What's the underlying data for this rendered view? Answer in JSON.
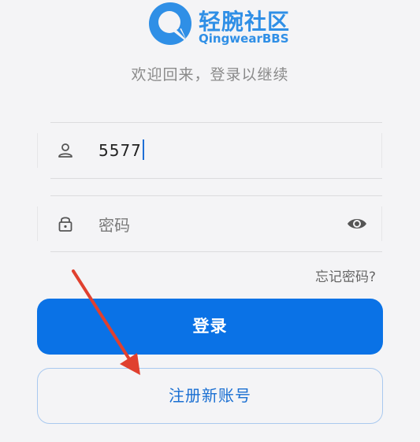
{
  "logo": {
    "cn_text": "轻腕社区",
    "en_text": "QingwearBBS"
  },
  "subtitle": "欢迎回来，登录以继续",
  "username_field": {
    "value": "5577",
    "icon": "user-icon"
  },
  "password_field": {
    "placeholder": "密码",
    "icon": "lock-icon",
    "toggle_icon": "eye-icon"
  },
  "forgot_password": "忘记密码?",
  "login_button": "登录",
  "register_button": "注册新账号",
  "annotation": {
    "arrow_color": "#e0402f"
  },
  "colors": {
    "primary": "#0a72e6",
    "logo": "#2f8fe6",
    "background": "#f4f4f6"
  }
}
